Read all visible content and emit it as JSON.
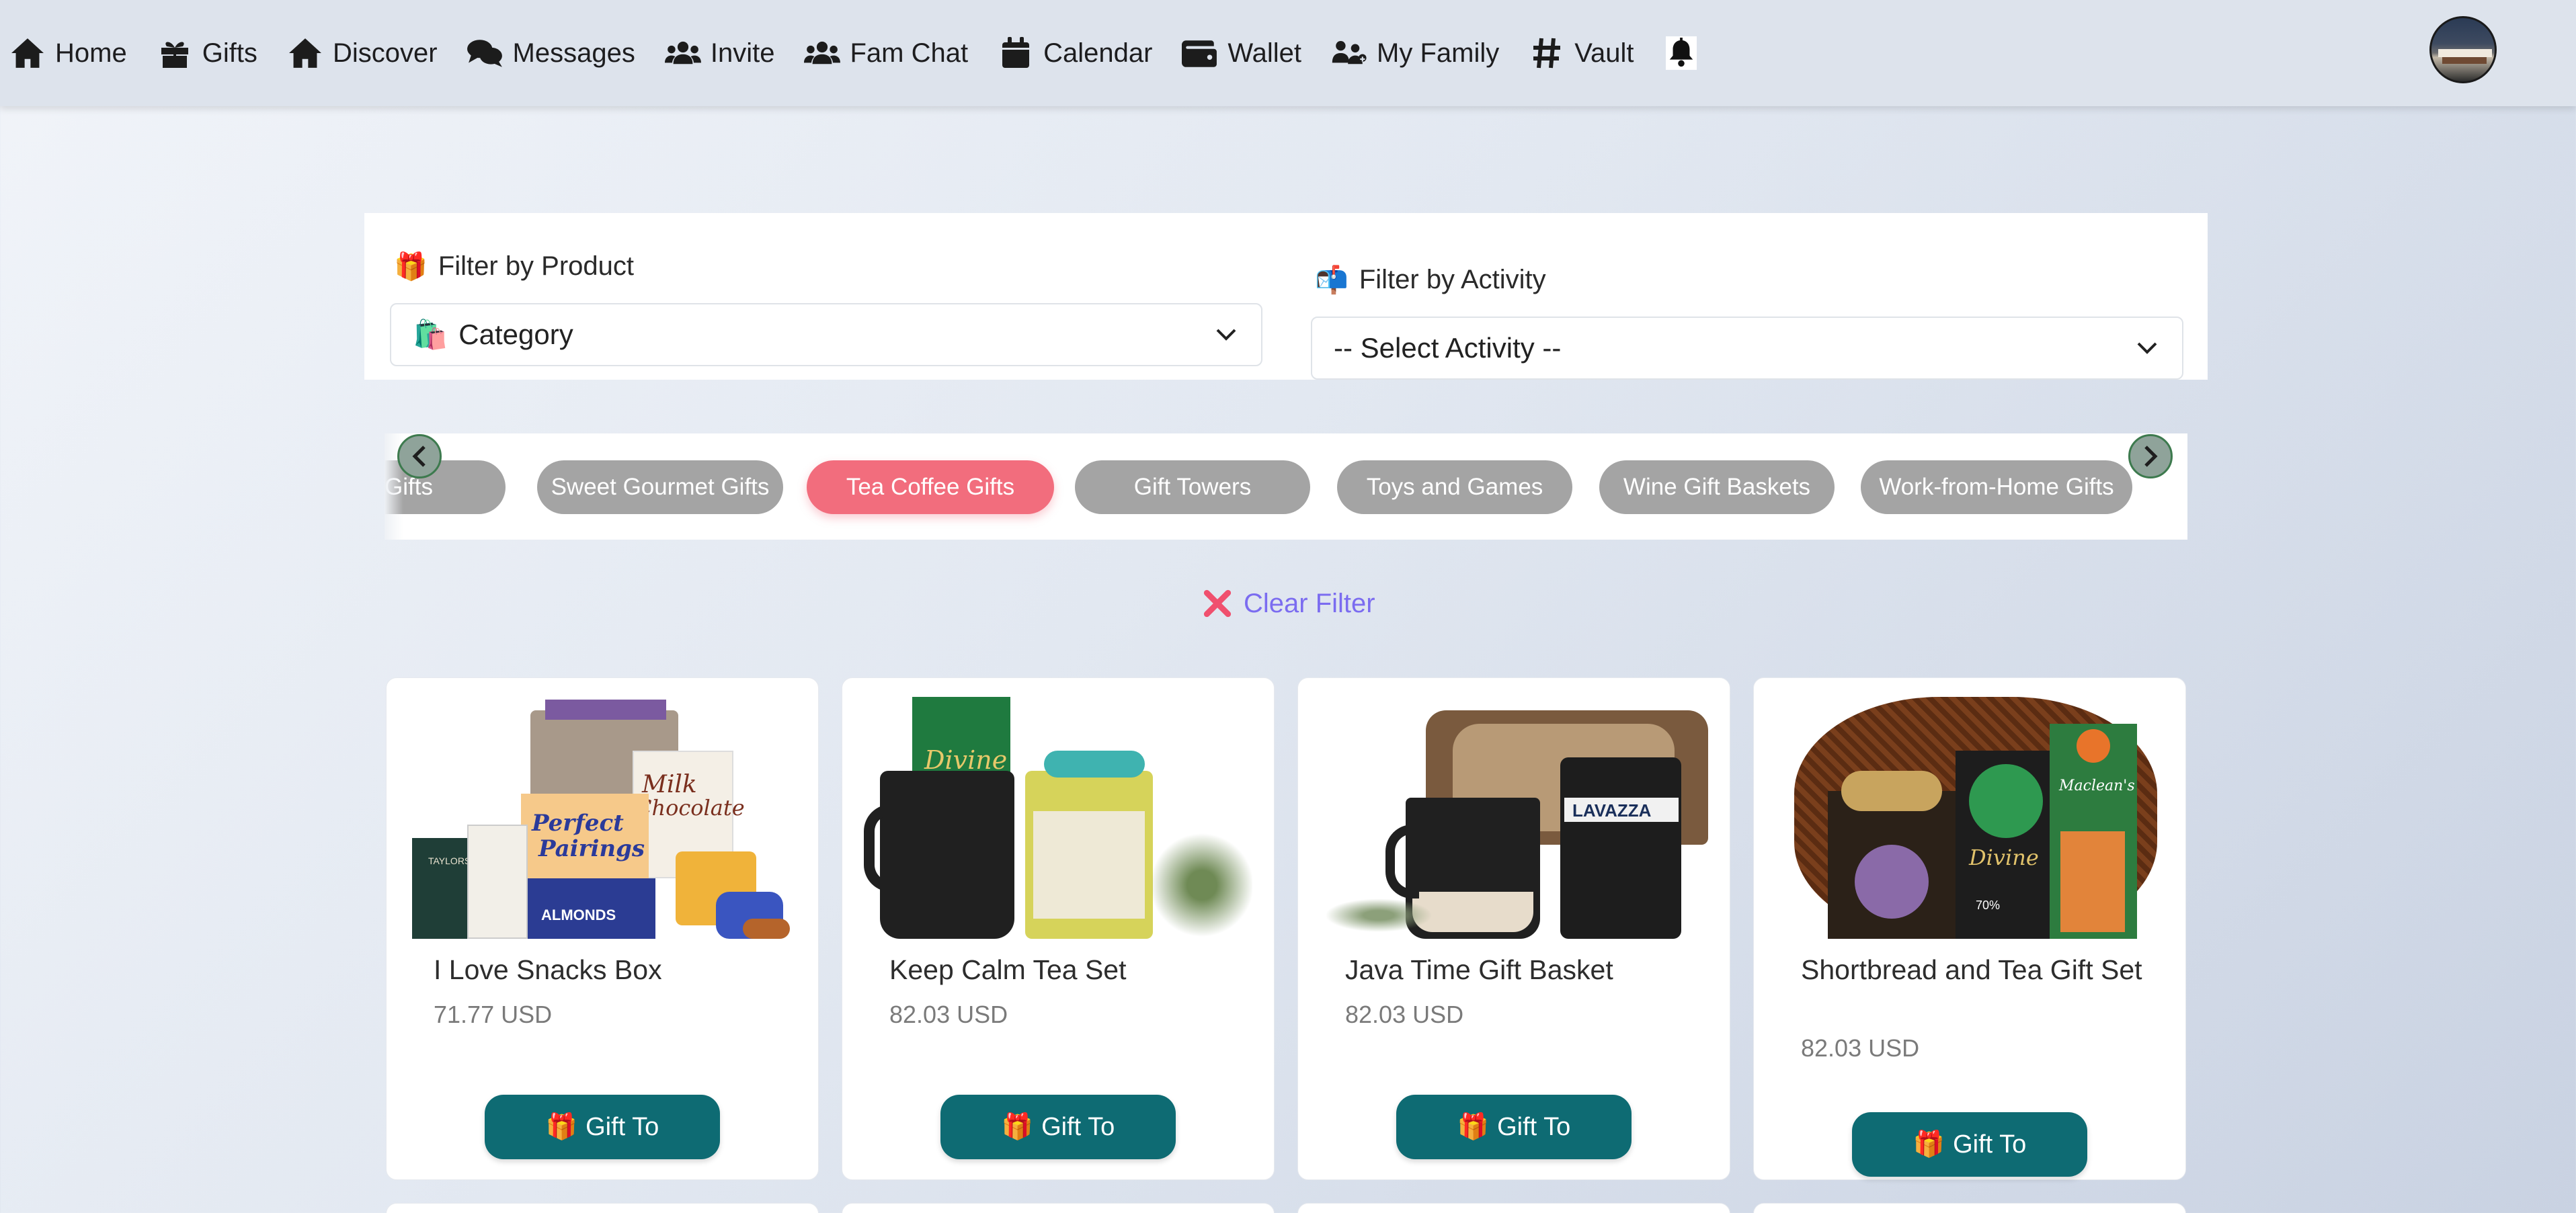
{
  "nav": {
    "items": [
      {
        "label": "Home",
        "icon": "home-icon"
      },
      {
        "label": "Gifts",
        "icon": "gift-icon"
      },
      {
        "label": "Discover",
        "icon": "home-icon"
      },
      {
        "label": "Messages",
        "icon": "comments-icon"
      },
      {
        "label": "Invite",
        "icon": "users-icon"
      },
      {
        "label": "Fam Chat",
        "icon": "users-icon"
      },
      {
        "label": "Calendar",
        "icon": "calendar-icon"
      },
      {
        "label": "Wallet",
        "icon": "wallet-icon"
      },
      {
        "label": "My Family",
        "icon": "family-icon"
      },
      {
        "label": "Vault",
        "icon": "hashtag-icon"
      }
    ],
    "bell_icon": "bell-icon",
    "avatar_icon": "user-avatar"
  },
  "filters": {
    "product_label": "Filter by Product",
    "product_emoji": "🎁",
    "category_value": "Category",
    "category_emoji": "🛍️",
    "activity_label": "Filter by Activity",
    "activity_emoji": "📬",
    "activity_value": "-- Select Activity --"
  },
  "categories": [
    {
      "label": "Gifts",
      "active": false
    },
    {
      "label": "Sweet Gourmet Gifts",
      "active": false
    },
    {
      "label": "Tea Coffee Gifts",
      "active": true
    },
    {
      "label": "Gift Towers",
      "active": false
    },
    {
      "label": "Toys and Games",
      "active": false
    },
    {
      "label": "Wine Gift Baskets",
      "active": false
    },
    {
      "label": "Work-from-Home Gifts",
      "active": false
    }
  ],
  "clear_filter": "Clear Filter",
  "products": [
    {
      "name": "I Love Snacks Box",
      "price": "71.77 USD",
      "button": "Gift To"
    },
    {
      "name": "Keep Calm Tea Set",
      "price": "82.03 USD",
      "button": "Gift To"
    },
    {
      "name": "Java Time Gift Basket",
      "price": "82.03 USD",
      "button": "Gift To"
    },
    {
      "name": "Shortbread and Tea Gift Set",
      "price": "82.03 USD",
      "button": "Gift To"
    }
  ],
  "product_art_labels": {
    "p1": [
      "Perfect",
      "Pairings",
      "Milk",
      "Chocolate",
      "ALMONDS",
      "TAYLORS"
    ],
    "p2": [
      "Divine"
    ],
    "p3": [
      "LAVAZZA"
    ],
    "p4": [
      "Divine",
      "Maclean's",
      "70%"
    ]
  },
  "button_emoji": "🎁",
  "colors": {
    "accent": "#0e6b73",
    "active_pill": "#f26d7d",
    "pill": "#a4a4a4",
    "clear_filter": "#7b6cf0"
  }
}
